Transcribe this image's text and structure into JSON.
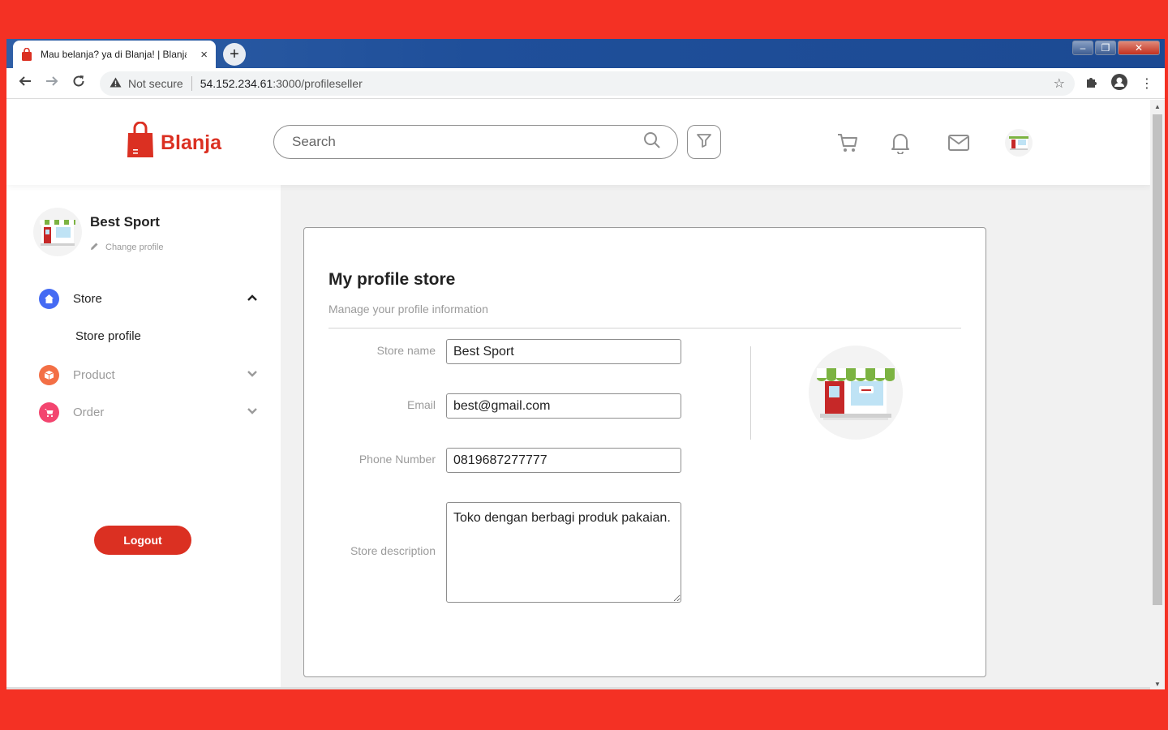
{
  "browser": {
    "tab_title": "Mau belanja? ya di Blanja! | Blanja",
    "tab_close": "×",
    "new_tab": "+",
    "security_label": "Not secure",
    "url_host": "54.152.234.61",
    "url_path": ":3000/profileseller"
  },
  "header": {
    "logo_text": "Blanja",
    "search_placeholder": "Search"
  },
  "sidebar": {
    "store_name": "Best Sport",
    "change_profile": "Change profile",
    "menu": [
      {
        "label": "Store",
        "color": "#456bf3",
        "expanded": true
      },
      {
        "label": "Product",
        "color": "#f36f45",
        "expanded": false
      },
      {
        "label": "Order",
        "color": "#f3456f",
        "expanded": false
      }
    ],
    "submenu_store": "Store profile",
    "logout": "Logout"
  },
  "card": {
    "title": "My profile store",
    "subtitle": "Manage your profile information",
    "fields": {
      "store_name_label": "Store name",
      "store_name_value": "Best Sport",
      "email_label": "Email",
      "email_value": "best@gmail.com",
      "phone_label": "Phone Number",
      "phone_value": "0819687277777",
      "description_label": "Store description",
      "description_value": "Toko dengan berbagi produk pakaian."
    }
  },
  "colors": {
    "brand": "#db3022",
    "background": "#f43124"
  }
}
